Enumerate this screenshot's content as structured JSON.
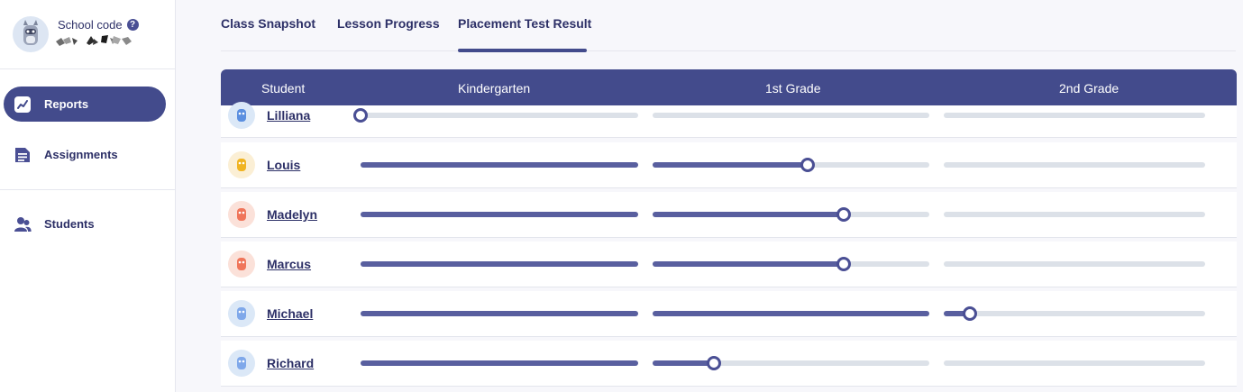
{
  "sidebar": {
    "school_code_label": "School code",
    "help_icon": "?",
    "nav": [
      {
        "label": "Reports",
        "icon": "chart-line-icon",
        "active": true
      },
      {
        "label": "Assignments",
        "icon": "document-icon",
        "active": false
      },
      {
        "label": "Students",
        "icon": "people-icon",
        "active": false
      }
    ]
  },
  "tabs": [
    {
      "label": "Class Snapshot",
      "active": false
    },
    {
      "label": "Lesson Progress",
      "active": false
    },
    {
      "label": "Placement Test Result",
      "active": true
    }
  ],
  "table": {
    "columns": [
      "Student",
      "Kindergarten",
      "1st Grade",
      "2nd Grade"
    ],
    "rows": [
      {
        "name": "Lilliana",
        "avatar_color": "#dbe8f7",
        "avatar_figure": "#5b8fe0",
        "progress": [
          0,
          0,
          0
        ]
      },
      {
        "name": "Louis",
        "avatar_color": "#fbefd5",
        "avatar_figure": "#f0b422",
        "progress": [
          1,
          0.56,
          0
        ]
      },
      {
        "name": "Madelyn",
        "avatar_color": "#fbe1d9",
        "avatar_figure": "#f0755a",
        "progress": [
          1,
          0.69,
          0
        ]
      },
      {
        "name": "Marcus",
        "avatar_color": "#fbe1d9",
        "avatar_figure": "#f0755a",
        "progress": [
          1,
          0.69,
          0
        ]
      },
      {
        "name": "Michael",
        "avatar_color": "#dbe8f7",
        "avatar_figure": "#7fa8ea",
        "progress": [
          1,
          1,
          0.1
        ]
      },
      {
        "name": "Richard",
        "avatar_color": "#dbe8f7",
        "avatar_figure": "#7fa8ea",
        "progress": [
          1,
          0.22,
          0
        ]
      }
    ]
  },
  "colors": {
    "accent": "#434b8c",
    "fill": "#595f9f",
    "track": "#dce1e8"
  }
}
